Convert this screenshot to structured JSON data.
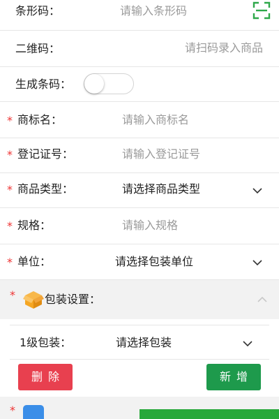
{
  "fields": {
    "barcode": {
      "label": "条形码：",
      "placeholder": "请输入条形码"
    },
    "qrcode": {
      "label": "二维码：",
      "placeholder": "请扫码录入商品"
    },
    "generate_barcode": {
      "label": "生成条码：",
      "enabled": false
    },
    "brand_name": {
      "required": "*",
      "label": "商标名：",
      "placeholder": "请输入商标名"
    },
    "registration_no": {
      "required": "*",
      "label": "登记证号：",
      "placeholder": "请输入登记证号"
    },
    "product_type": {
      "required": "*",
      "label": "商品类型：",
      "value": "请选择商品类型"
    },
    "spec": {
      "required": "*",
      "label": "规格：",
      "placeholder": "请输入规格"
    },
    "unit": {
      "required": "*",
      "label": "单位：",
      "value": "请选择包装单位"
    }
  },
  "packaging": {
    "required": "*",
    "title": "包装设置：",
    "level1_label": "1级包装：",
    "level1_value": "请选择包装",
    "delete_label": "删除",
    "add_label": "新增"
  },
  "colors": {
    "required": "#e33333",
    "scan_icon": "#2ea84a",
    "delete": "#e8404f",
    "add": "#1e9a4c",
    "box_icon": "#f5a623"
  },
  "icons": {
    "scan": "scan-icon",
    "box": "box-icon",
    "chevron": "chevron-down-icon"
  }
}
